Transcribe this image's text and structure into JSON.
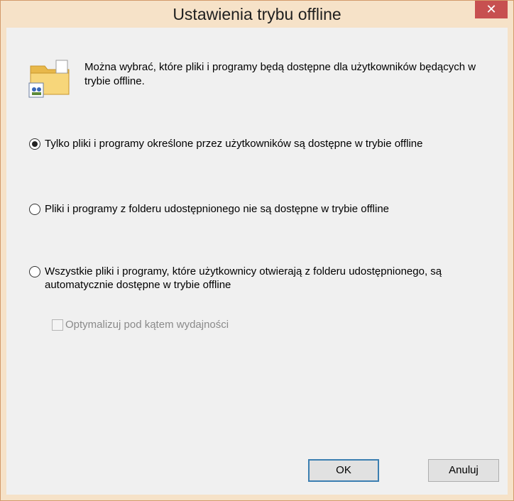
{
  "window": {
    "title": "Ustawienia trybu offline",
    "close_glyph": "✕"
  },
  "intro": {
    "text": "Można wybrać, które pliki i programy będą dostępne dla użytkowników będących w trybie offline.",
    "icon": "offline-folder-icon"
  },
  "options": [
    {
      "label": "Tylko pliki i programy określone przez użytkowników są dostępne w trybie offline",
      "selected": true
    },
    {
      "label": "Pliki i programy z folderu udostępnionego nie są dostępne w trybie offline",
      "selected": false
    },
    {
      "label": "Wszystkie pliki i programy, które użytkownicy otwierają z folderu udostępnionego, są automatycznie dostępne w trybie offline",
      "selected": false
    }
  ],
  "optimize": {
    "label": "Optymalizuj pod kątem wydajności",
    "checked": false,
    "enabled": false
  },
  "buttons": {
    "ok": "OK",
    "cancel": "Anuluj"
  },
  "colors": {
    "frame": "#f6e2c8",
    "close": "#c75050",
    "client": "#f0f0f0",
    "default_button_border": "#3c7fb1"
  }
}
